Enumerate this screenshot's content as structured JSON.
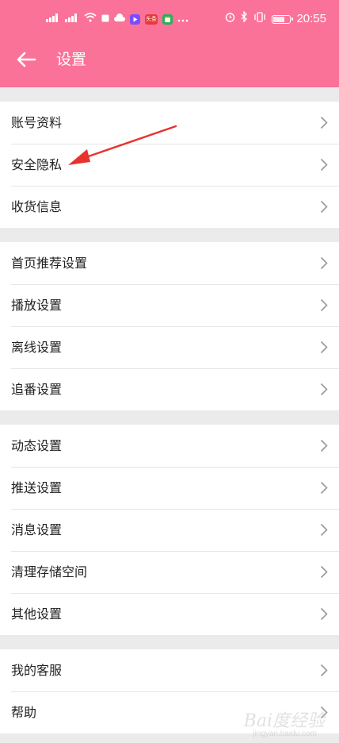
{
  "statusbar": {
    "left_icons": [
      "signal-1-icon",
      "signal-2-icon",
      "wifi-icon",
      "notification-icon",
      "cloud-icon",
      "app-video-icon",
      "app-toutiao-icon",
      "app-calendar-icon",
      "more-dots-icon"
    ],
    "right_icons": [
      "alarm-icon",
      "bluetooth-icon",
      "vibrate-icon",
      "battery-icon"
    ],
    "toutiao_label": "头条",
    "time": "20:55",
    "colors": {
      "app_video": "#7b4dff",
      "app_toutiao": "#e83a3a",
      "app_calendar": "#27b05a"
    }
  },
  "header": {
    "title": "设置",
    "background": "#fb7299"
  },
  "groups": [
    {
      "items": [
        "账号资料",
        "安全隐私",
        "收货信息"
      ]
    },
    {
      "items": [
        "首页推荐设置",
        "播放设置",
        "离线设置",
        "追番设置"
      ]
    },
    {
      "items": [
        "动态设置",
        "推送设置",
        "消息设置",
        "清理存储空间",
        "其他设置"
      ]
    },
    {
      "items": [
        "我的客服",
        "帮助"
      ]
    }
  ],
  "annotation": {
    "color": "#e8322e",
    "points_to": "安全隐私"
  },
  "watermark": {
    "text": "Bai度经验",
    "sub": "jingyan.baidu.com"
  }
}
